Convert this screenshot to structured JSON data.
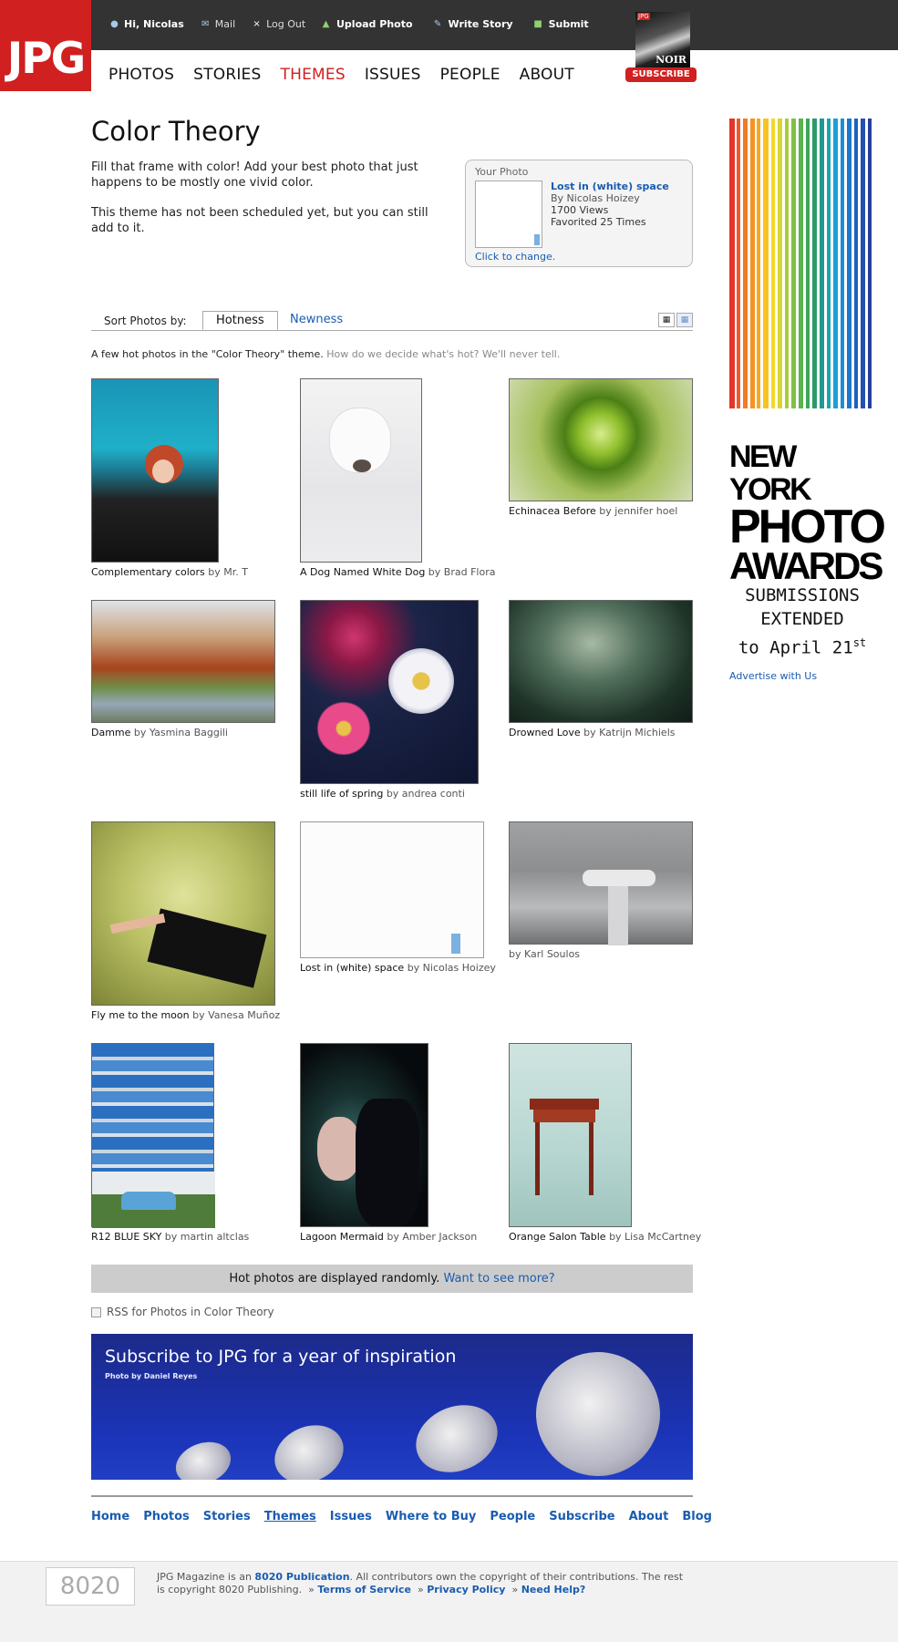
{
  "brand": {
    "logo": "JPG",
    "accent": "#d0201f"
  },
  "user_nav": [
    {
      "label": "Hi, Nicolas",
      "icon": "user-icon"
    },
    {
      "label": "Mail",
      "icon": "mail-icon"
    },
    {
      "label": "Log Out",
      "icon": "close-icon"
    }
  ],
  "actions": [
    {
      "label": "Upload Photo",
      "icon": "upload-icon"
    },
    {
      "label": "Write Story",
      "icon": "pencil-icon"
    },
    {
      "label": "Submit",
      "icon": "submit-icon"
    }
  ],
  "magazine": {
    "cover_word": "NOIR",
    "cover_brand": "JPG",
    "subscribe_label": "SUBSCRIBE"
  },
  "main_nav": [
    {
      "label": "PHOTOS",
      "active": false
    },
    {
      "label": "STORIES",
      "active": false
    },
    {
      "label": "THEMES",
      "active": true
    },
    {
      "label": "ISSUES",
      "active": false
    },
    {
      "label": "PEOPLE",
      "active": false
    },
    {
      "label": "ABOUT",
      "active": false
    }
  ],
  "theme": {
    "title": "Color Theory",
    "description": "Fill that frame with color! Add your best photo that just happens to be mostly one vivid color.",
    "schedule_note": "This theme has not been scheduled yet, but you can still add to it."
  },
  "your_photo": {
    "label": "Your Photo",
    "title": "Lost in (white) space",
    "byline": "By Nicolas Hoizey",
    "views": "1700 Views",
    "favorited": "Favorited 25 Times",
    "change_link": "Click to change."
  },
  "sort": {
    "label": "Sort Photos by:",
    "options": [
      "Hotness",
      "Newness"
    ],
    "selected": "Hotness"
  },
  "hot_note": {
    "text": "A few hot photos in the \"Color Theory\" theme.",
    "muted": "How do we decide what's hot? We'll never tell."
  },
  "photos": [
    {
      "title": "Complementary colors",
      "by": "by Mr. T"
    },
    {
      "title": "A Dog Named White Dog",
      "by": "by Brad Flora"
    },
    {
      "title": "Echinacea Before",
      "by": "by jennifer hoel"
    },
    {
      "title": "Damme",
      "by": "by Yasmina Baggili"
    },
    {
      "title": "still life of spring",
      "by": "by andrea conti"
    },
    {
      "title": "Drowned Love",
      "by": "by Katrijn Michiels"
    },
    {
      "title": "Fly me to the moon",
      "by": "by Vanesa Muñoz"
    },
    {
      "title": "Lost in (white) space",
      "by": "by Nicolas Hoizey"
    },
    {
      "title": "",
      "by": "by Karl Soulos"
    },
    {
      "title": "R12 BLUE SKY",
      "by": "by martin altclas"
    },
    {
      "title": "Lagoon Mermaid",
      "by": "by Amber Jackson"
    },
    {
      "title": "Orange Salon Table",
      "by": "by Lisa McCartney"
    }
  ],
  "hot_bar": {
    "text": "Hot photos are displayed randomly.",
    "link": "Want to see more?"
  },
  "rss": {
    "label": "RSS for Photos in Color Theory"
  },
  "banner": {
    "title": "Subscribe to JPG for a year of inspiration",
    "credit": "Photo by Daniel Reyes"
  },
  "footer_nav": [
    {
      "label": "Home",
      "current": false
    },
    {
      "label": "Photos",
      "current": false
    },
    {
      "label": "Stories",
      "current": false
    },
    {
      "label": "Themes",
      "current": true
    },
    {
      "label": "Issues",
      "current": false
    },
    {
      "label": "Where to Buy",
      "current": false
    },
    {
      "label": "People",
      "current": false
    },
    {
      "label": "Subscribe",
      "current": false
    },
    {
      "label": "About",
      "current": false
    },
    {
      "label": "Blog",
      "current": false
    }
  ],
  "legal": {
    "publisher_logo": "8020",
    "prefix": "JPG Magazine is an",
    "publication_link": "8020 Publication",
    "text": ". All contributors own the copyright of their contributions. The rest is copyright 8020 Publishing.",
    "links": [
      "Terms of Service",
      "Privacy Policy",
      "Need Help?"
    ]
  },
  "sidebar_ad": {
    "line1": "NEW YORK",
    "line2": "PHOTO",
    "line3": "AWARDS",
    "sub1": "SUBMISSIONS",
    "sub2": "EXTENDED",
    "sub3": "to April 21",
    "sub3_sup": "st",
    "advertise": "Advertise with Us"
  }
}
